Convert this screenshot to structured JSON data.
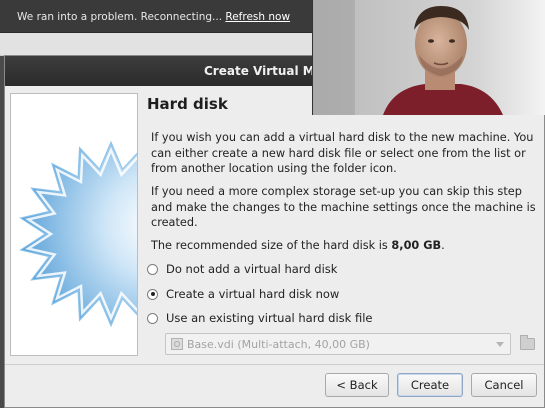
{
  "banner": {
    "message": "We ran into a problem. Reconnecting...",
    "link": "Refresh now"
  },
  "dialog": {
    "title": "Create Virtual Ma",
    "heading": "Hard disk",
    "para1": "If you wish you can add a virtual hard disk to the new machine. You can either create a new hard disk file or select one from the list or from another location using the folder icon.",
    "para2": "If you need a more complex storage set-up you can skip this step and make the changes to the machine settings once the machine is created.",
    "recommended_prefix": "The recommended size of the hard disk is ",
    "recommended_size": "8,00 GB",
    "recommended_suffix": ".",
    "options": [
      {
        "label": "Do not add a virtual hard disk",
        "checked": false
      },
      {
        "label": "Create a virtual hard disk now",
        "checked": true
      },
      {
        "label": "Use an existing virtual hard disk file",
        "checked": false
      }
    ],
    "file_combo_value": "Base.vdi (Multi-attach, 40,00 GB)",
    "buttons": {
      "back": "< Back",
      "create": "Create",
      "cancel": "Cancel"
    }
  },
  "colors": {
    "banner_bg": "#3a3a3a",
    "dialog_bg": "#ededed",
    "star_blue": "#6fb0df"
  },
  "icons": [
    "folder-icon",
    "disk-icon",
    "dropdown-arrow-icon"
  ]
}
